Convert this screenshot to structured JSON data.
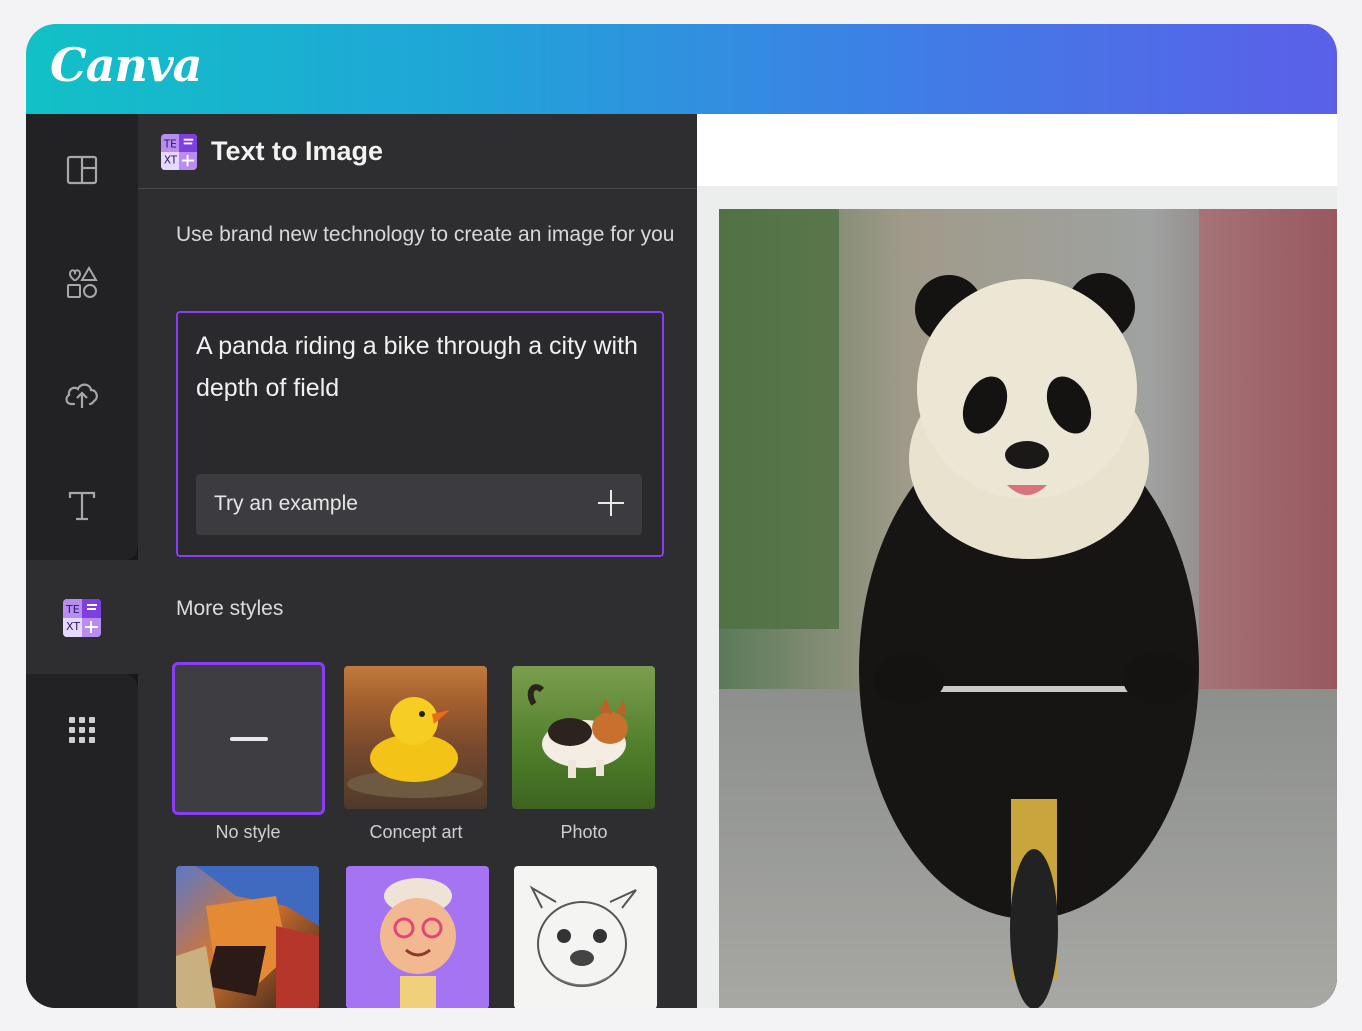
{
  "app": {
    "name": "Canva"
  },
  "sidebar": {
    "items": [
      {
        "icon": "layout-panel-icon"
      },
      {
        "icon": "elements-shapes-icon"
      },
      {
        "icon": "upload-cloud-icon"
      },
      {
        "icon": "text-icon"
      },
      {
        "icon": "text-to-image-app-icon",
        "active": true
      },
      {
        "icon": "apps-grid-icon"
      }
    ]
  },
  "panel": {
    "title": "Text to Image",
    "description": "Use brand new technology to create an image for you",
    "prompt": {
      "value": "A panda riding a bike through a city with depth of field",
      "try_example_label": "Try an example"
    },
    "styles_heading": "More styles",
    "styles": [
      {
        "label": "No style",
        "selected": true
      },
      {
        "label": "Concept art"
      },
      {
        "label": "Photo"
      },
      {
        "label": ""
      },
      {
        "label": ""
      },
      {
        "label": ""
      }
    ]
  },
  "colors": {
    "accent": "#8b3df5",
    "header_gradient_start": "#12c1c6",
    "header_gradient_end": "#5b5fe8",
    "panel_bg": "#2e2e30",
    "rail_bg": "#222224"
  }
}
